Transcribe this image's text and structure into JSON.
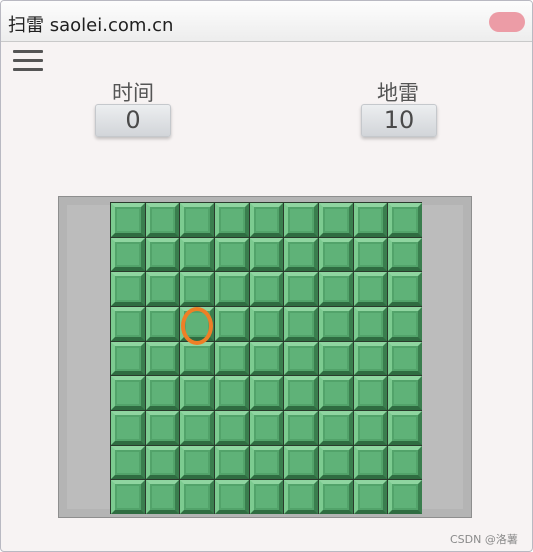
{
  "window": {
    "title": "扫雷 saolei.com.cn"
  },
  "stats": {
    "time_label": "时间",
    "time_value": "0",
    "mines_label": "地雷",
    "mines_value": "10"
  },
  "board": {
    "rows": 9,
    "cols": 9,
    "state": "all-covered",
    "highlight_cell": {
      "row": 4,
      "col": 3
    }
  },
  "icons": [
    "menu-icon",
    "close-icon"
  ],
  "colors": {
    "tile": "#5fb278",
    "cursor": "#ee7f26",
    "close_button": "#ec9ca6"
  },
  "watermark": "CSDN @洛薯"
}
